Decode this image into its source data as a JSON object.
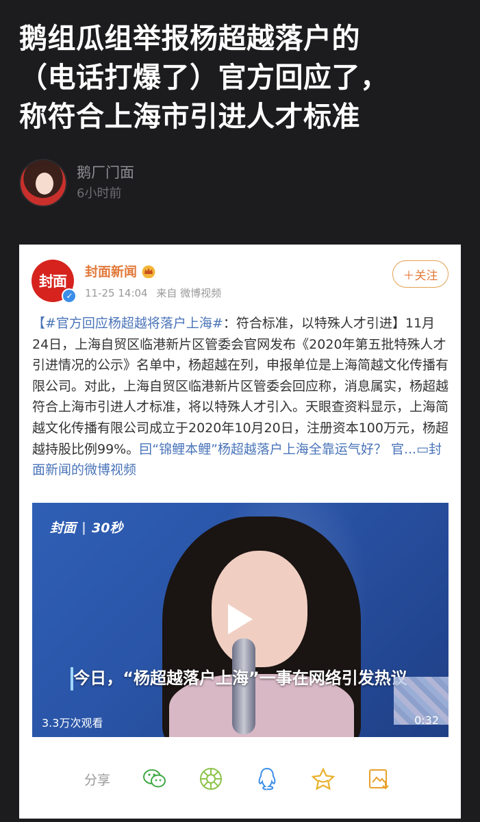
{
  "article": {
    "headline_line1": "鹅组瓜组举报杨超越落户的",
    "headline_line2": "（电话打爆了）官方回应了，",
    "headline_line3": "称符合上海市引进人才标准",
    "author_name": "鹅厂门面",
    "time": "6小时前"
  },
  "weibo": {
    "logo_text": "封面",
    "account_name": "封面新闻",
    "timestamp": "11-25 14:04",
    "source": "来自 微博视频",
    "follow_label": "＋关注",
    "post_hashtag": "【#官方回应杨超越将落户上海#",
    "post_tagline": "：符合标准，以特殊人才引进】",
    "post_body": "11月24日，上海自贸区临港新片区管委会官网发布《2020年第五批特殊人才引进情况的公示》名单中，杨超越在列，申报单位是上海简越文化传播有限公司。对此，上海自贸区临港新片区管委会回应称，消息属实，杨超越符合上海市引进人才标准，将以特殊人才引入。天眼查资料显示，上海简越文化传播有限公司成立于2020年10月20日，注册资本100万元，杨超越持股比例99%。",
    "post_link1": "囙“锦鲤本鲤”杨超越落户上海全靠运气好？ 官...",
    "post_link2": "▭封面新闻的微博视频",
    "colors": {
      "accent": "#e2793a",
      "link": "#4a74b9",
      "brand": "#d6231d"
    }
  },
  "video": {
    "logo": "封面",
    "logo_sub": "30秒",
    "subtitle": "今日，“杨超越落户上海”一事在网络引发热议",
    "views": "3.3万次观看",
    "duration": "0:32"
  },
  "share": {
    "label": "分享",
    "icons": [
      "wechat-icon",
      "moments-icon",
      "qq-icon",
      "favorite-icon",
      "image-share-icon"
    ]
  }
}
